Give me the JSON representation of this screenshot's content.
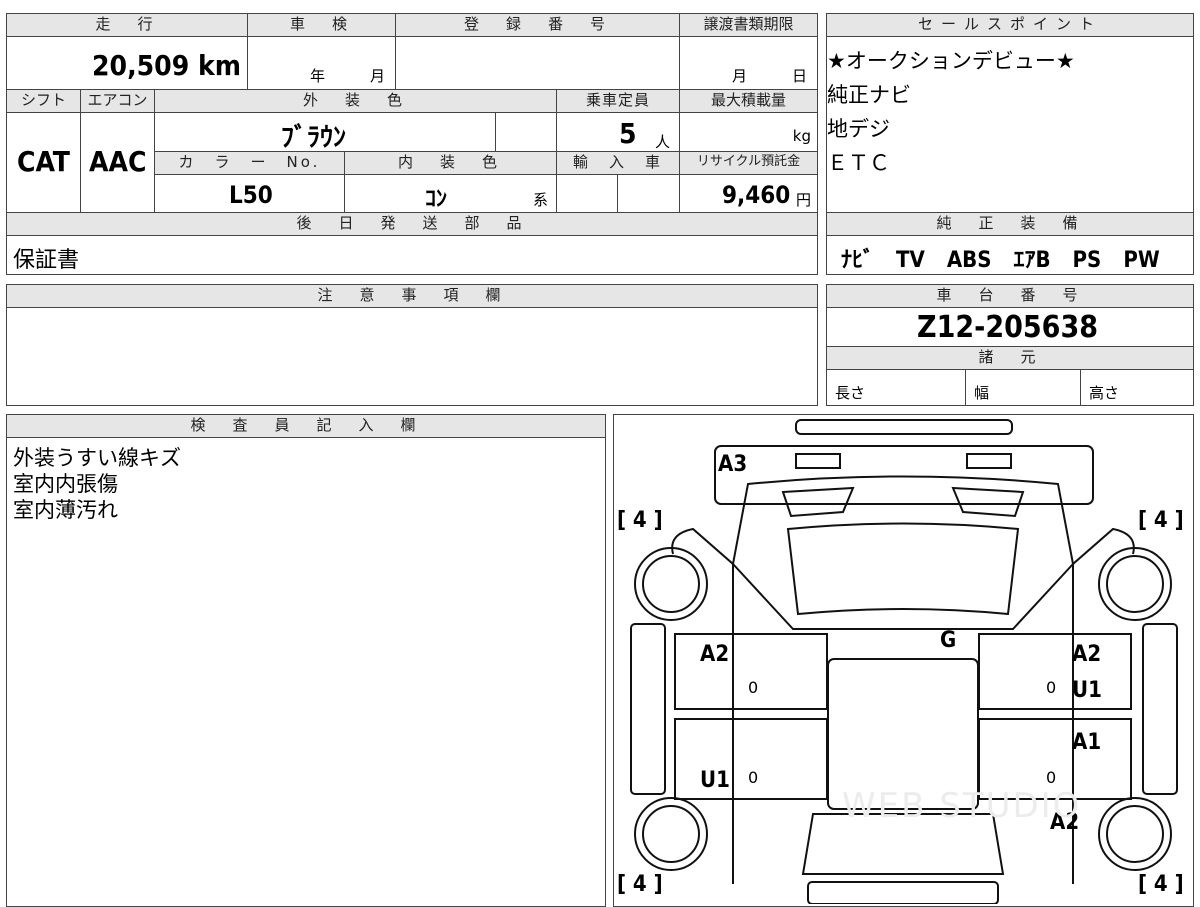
{
  "top_left": {
    "h_mileage": "走　行",
    "h_inspection": "車　検",
    "h_reg_no": "登　録　番　号",
    "h_transfer_deadline": "譲渡書類期限",
    "mileage": "20,509 km",
    "inspection_year": "年",
    "inspection_month": "月",
    "transfer_month": "月",
    "transfer_day": "日",
    "h_shift": "シフト",
    "h_aircon": "エアコン",
    "h_exterior_color": "外　装　色",
    "h_capacity": "乗車定員",
    "h_max_load": "最大積載量",
    "shift": "CAT",
    "aircon": "AAC",
    "exterior_color": "ﾌﾞﾗｳﾝ",
    "capacity": "5",
    "capacity_unit": "人",
    "max_load_unit": "kg",
    "h_color_no": "カ　ラ　ー　No.",
    "h_interior_color": "内　装　色",
    "h_import": "輸　入　車",
    "h_recycle": "リサイクル預託金",
    "color_no": "L50",
    "interior_color": "ｺﾝ",
    "interior_suffix": "系",
    "recycle_fee": "9,460",
    "recycle_unit": "円",
    "h_later_parts": "後　日　発　送　部　品",
    "later_parts": "保証書"
  },
  "sales_point": {
    "header": "セールスポイント",
    "lines": [
      "★オークションデビュー★",
      "純正ナビ",
      "地デジ",
      "ＥＴＣ"
    ]
  },
  "oem_equipment": {
    "header": "純　正　装　備",
    "value": "ﾅﾋﾞ　TV　ABS　ｴｱB　PS　PW"
  },
  "notes": {
    "header": "注　意　事　項　欄"
  },
  "chassis": {
    "header": "車　台　番　号",
    "number": "Z12-205638",
    "spec_header": "諸　元",
    "length": "長さ",
    "width": "幅",
    "height": "高さ"
  },
  "inspector": {
    "header": "検　査　員　記　入　欄",
    "lines": [
      "外装うすい線キズ",
      "室内内張傷",
      "室内薄汚れ"
    ]
  },
  "diagram": {
    "tires": [
      "[ 4 ]",
      "[ 4 ]",
      "[ 4 ]",
      "[ 4 ]"
    ],
    "marks": [
      "A3",
      "G",
      "A2",
      "A2",
      "U1",
      "A1",
      "U1",
      "A2"
    ],
    "zeros": [
      "0",
      "0",
      "0",
      "0"
    ],
    "watermark": "WEB STUDIO"
  }
}
